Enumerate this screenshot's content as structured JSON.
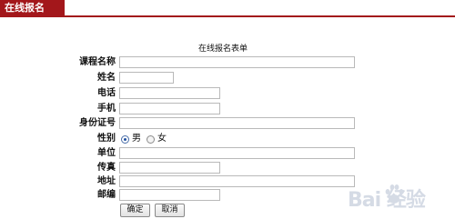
{
  "header": {
    "tab_label": "在线报名",
    "accent_color": "#a3171b"
  },
  "form": {
    "title": "在线报名表单",
    "fields": {
      "course": {
        "label": "课程名称",
        "value": ""
      },
      "name": {
        "label": "姓名",
        "value": ""
      },
      "phone": {
        "label": "电话",
        "value": ""
      },
      "mobile": {
        "label": "手机",
        "value": ""
      },
      "id_number": {
        "label": "身份证号",
        "value": ""
      },
      "gender": {
        "label": "性别",
        "options": [
          "男",
          "女"
        ],
        "selected": "男"
      },
      "company": {
        "label": "单位",
        "value": ""
      },
      "fax": {
        "label": "传真",
        "value": ""
      },
      "address": {
        "label": "地址",
        "value": ""
      },
      "postcode": {
        "label": "邮编",
        "value": ""
      }
    },
    "buttons": {
      "submit_label": "确定",
      "cancel_label": "取消"
    }
  },
  "watermark": {
    "text": "Bai 经验",
    "icon": "baidu-paw-icon"
  }
}
